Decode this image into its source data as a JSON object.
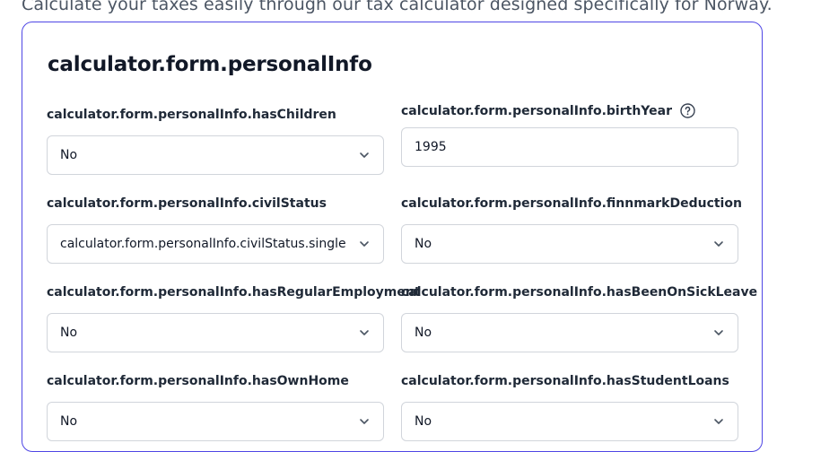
{
  "intro": "Calculate your taxes easily through our tax calculator designed specifically for Norway.",
  "card": {
    "title": "calculator.form.personalInfo"
  },
  "fields": {
    "hasChildren": {
      "label": "calculator.form.personalInfo.hasChildren",
      "value": "No"
    },
    "birthYear": {
      "label": "calculator.form.personalInfo.birthYear",
      "value": "1995",
      "icon": "help-circle-icon"
    },
    "civilStatus": {
      "label": "calculator.form.personalInfo.civilStatus",
      "value": "calculator.form.personalInfo.civilStatus.single"
    },
    "finnmarkDeduction": {
      "label": "calculator.form.personalInfo.finnmarkDeduction",
      "value": "No"
    },
    "hasRegularEmployment": {
      "label": "calculator.form.personalInfo.hasRegularEmployment",
      "value": "No"
    },
    "hasBeenOnSickLeave": {
      "label": "calculator.form.personalInfo.hasBeenOnSickLeave",
      "value": "No"
    },
    "hasOwnHome": {
      "label": "calculator.form.personalInfo.hasOwnHome",
      "value": "No"
    },
    "hasStudentLoans": {
      "label": "calculator.form.personalInfo.hasStudentLoans",
      "value": "No"
    }
  },
  "colors": {
    "accent": "#4f46e5",
    "border": "#d1d5db",
    "text": "#111827",
    "muted": "#4b5563"
  }
}
